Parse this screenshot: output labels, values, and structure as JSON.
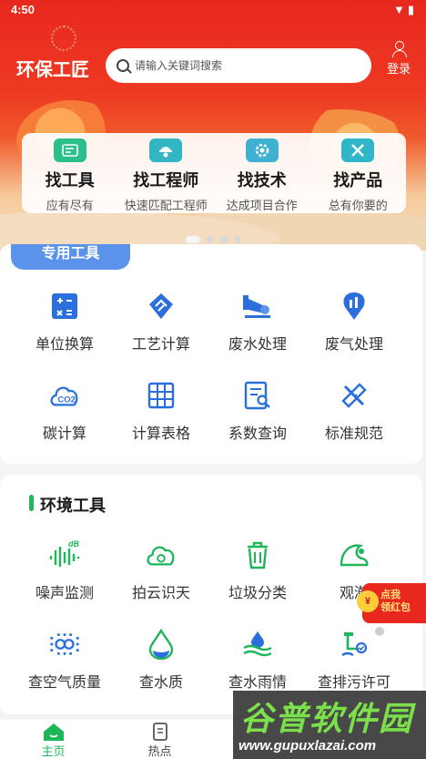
{
  "status_bar": {
    "time": "4:50",
    "icons": [
      "wifi-icon",
      "battery-icon"
    ]
  },
  "header": {
    "app_title": "环保工匠",
    "search_placeholder": "请输入关键词搜索",
    "login_label": "登录"
  },
  "quick_nav": [
    {
      "title": "找工具",
      "subtitle": "应有尽有",
      "icon": "tools-icon",
      "color": "#2bbf8b"
    },
    {
      "title": "找工程师",
      "subtitle": "快速匹配工程师",
      "icon": "engineer-icon",
      "color": "#33b6c4"
    },
    {
      "title": "找技术",
      "subtitle": "达成项目合作",
      "icon": "gear-icon",
      "color": "#3fb2d2"
    },
    {
      "title": "找产品",
      "subtitle": "总有你要的",
      "icon": "wrench-icon",
      "color": "#2fb6c8"
    }
  ],
  "special_tools": {
    "title": "专用工具",
    "items": [
      {
        "label": "单位换算",
        "icon": "calculator-icon"
      },
      {
        "label": "工艺计算",
        "icon": "process-calc-icon"
      },
      {
        "label": "废水处理",
        "icon": "wastewater-icon"
      },
      {
        "label": "废气处理",
        "icon": "exhaust-gas-icon"
      },
      {
        "label": "碳计算",
        "icon": "co2-cloud-icon"
      },
      {
        "label": "计算表格",
        "icon": "table-grid-icon"
      },
      {
        "label": "系数查询",
        "icon": "coefficient-search-icon"
      },
      {
        "label": "标准规范",
        "icon": "ruler-pencil-icon"
      }
    ]
  },
  "env_tools": {
    "title": "环境工具",
    "items": [
      {
        "label": "噪声监测",
        "icon": "noise-db-icon"
      },
      {
        "label": "拍云识天",
        "icon": "cloud-camera-icon"
      },
      {
        "label": "垃圾分类",
        "icon": "trash-bin-icon"
      },
      {
        "label": "观潮",
        "icon": "tide-wave-icon"
      },
      {
        "label": "查空气质量",
        "icon": "air-quality-icon"
      },
      {
        "label": "查水质",
        "icon": "water-drop-icon"
      },
      {
        "label": "查水雨情",
        "icon": "rain-water-icon"
      },
      {
        "label": "查排污许可",
        "icon": "discharge-permit-icon"
      }
    ]
  },
  "red_packet": {
    "line1": "点我",
    "line2": "领红包",
    "coin": "¥"
  },
  "bottom_nav": [
    {
      "label": "主页",
      "icon": "home-icon",
      "active": true
    },
    {
      "label": "热点",
      "icon": "hot-news-icon",
      "active": false
    }
  ],
  "watermark": {
    "text": "谷普软件园",
    "url": "www.gupuxlazai.com"
  },
  "colors": {
    "brand_red": "#e8281e",
    "accent_green": "#1fb65a",
    "accent_blue": "#2a6fdb",
    "pill_blue": "#5b93ec"
  }
}
